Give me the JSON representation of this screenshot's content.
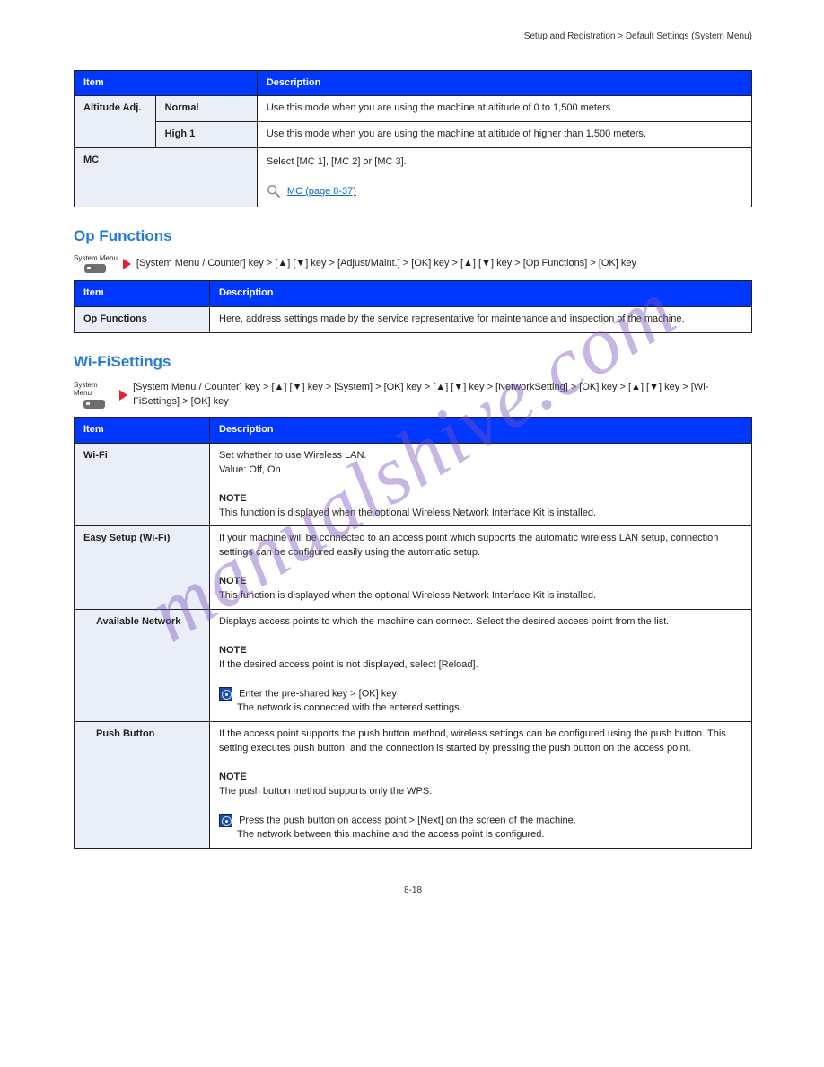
{
  "header": "Setup and Registration > Default Settings (System Menu)",
  "table1": {
    "h1": "Item",
    "h2": "Description",
    "r1a": "Altitude Adj.",
    "r1b": "Normal",
    "r1d": "Use this mode when you are using the machine at altitude of 0 to 1,500 meters.",
    "r2b": "High 1",
    "r2d": "Use this mode when you are using the machine at altitude of higher than 1,500 meters.",
    "r3a": "MC",
    "r3d_1": "Select [MC 1], [MC 2] or [MC 3].",
    "r3d_link": "MC (page 8-37)"
  },
  "section2": {
    "title": "Op Functions",
    "breadcrumb": "[System Menu / Counter] key > [▲] [▼] key > [Adjust/Maint.] > [OK] key > [▲] [▼] key > [Op Functions] > [OK] key",
    "h1": "Item",
    "h2": "Description",
    "r1a": "Op Functions",
    "r1d": "Here, address settings made by the service representative for maintenance and inspection of the machine."
  },
  "section3": {
    "title": "Wi-FiSettings",
    "breadcrumb": "[System Menu / Counter] key > [▲] [▼] key > [System] > [OK] key > [▲] [▼] key > [NetworkSetting] > [OK] key > [▲] [▼] key > [Wi-FiSettings] > [OK] key",
    "h1": "Item",
    "h2": "Description",
    "r1a": "Wi-Fi",
    "r1d_1": "Set whether to use Wireless LAN.",
    "r1d_2": "Value: Off, On",
    "r1d_note": "NOTE",
    "r1d_3": "This function is displayed when the optional Wireless Network Interface Kit is installed.",
    "r2a": "Easy Setup (Wi-Fi)",
    "r2d_1": "If your machine will be connected to an access point which supports the automatic wireless LAN setup, connection settings can be configured easily using the automatic setup.",
    "r2d_note": "NOTE",
    "r2d_2": "This function is displayed when the optional Wireless Network Interface Kit is installed.",
    "r3a": "Available Network",
    "r3d_1": "Displays access points to which the machine can connect. Select the desired access point from the list.",
    "r3d_note": "NOTE",
    "r3d_2": "If the desired access point is not displayed, select [Reload].",
    "r3d_net": "Enter the pre-shared key > [OK] key",
    "r3d_3": "The network is connected with the entered settings.",
    "r4a": "Push Button",
    "r4d_1": "If the access point supports the push button method, wireless settings can be configured using the push button. This setting executes push button, and the connection is started by pressing the push button on the access point.",
    "r4d_note": "NOTE",
    "r4d_2": "The push button method supports only the WPS.",
    "r4d_net": "Press the push button on access point > [Next] on the screen of the machine.",
    "r4d_3": "The network between this machine and the access point is configured."
  },
  "footer": "8-18"
}
